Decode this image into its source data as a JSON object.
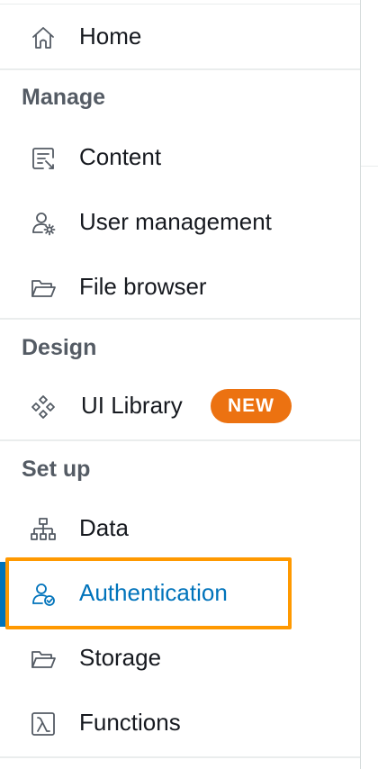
{
  "nav": {
    "home": "Home",
    "sections": {
      "manage": "Manage",
      "design": "Design",
      "setup": "Set up"
    },
    "items": {
      "content": "Content",
      "user_management": "User management",
      "file_browser": "File browser",
      "ui_library": "UI Library",
      "data": "Data",
      "authentication": "Authentication",
      "storage": "Storage",
      "functions": "Functions"
    },
    "badge_new": "NEW",
    "active_item": "Authentication"
  },
  "colors": {
    "active": "#0073bb",
    "highlight": "#ff9900",
    "badge": "#ec7211",
    "text": "#16191f",
    "section": "#545b64"
  },
  "icons": {
    "home": "home-icon",
    "content": "content-icon",
    "user_management": "user-gear-icon",
    "file_browser": "folder-icon",
    "ui_library": "ui-library-icon",
    "data": "hierarchy-icon",
    "authentication": "user-check-icon",
    "storage": "folder-icon",
    "functions": "lambda-icon"
  }
}
